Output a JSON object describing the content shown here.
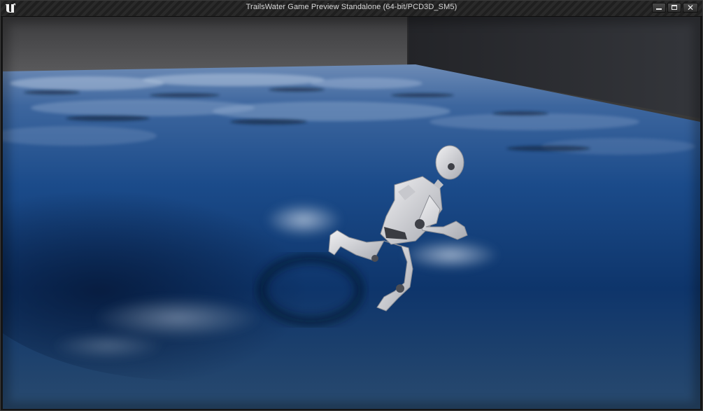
{
  "window": {
    "title": "TrailsWater Game Preview Standalone (64-bit/PCD3D_SM5)",
    "app_icon": "unreal-engine-logo",
    "controls": {
      "minimize_icon": "minimize-icon",
      "maximize_icon": "maximize-icon",
      "close_icon": "close-icon"
    }
  },
  "scene": {
    "description_icon": "game-viewport",
    "colors": {
      "back_wall": "#4a4a4c",
      "right_wall": "#2b2c30",
      "water_deep": "#0a2a55",
      "water_mid": "#1c4f8c",
      "water_highlight": "#9fb8d8",
      "mannequin": "#d9d9dc"
    }
  }
}
